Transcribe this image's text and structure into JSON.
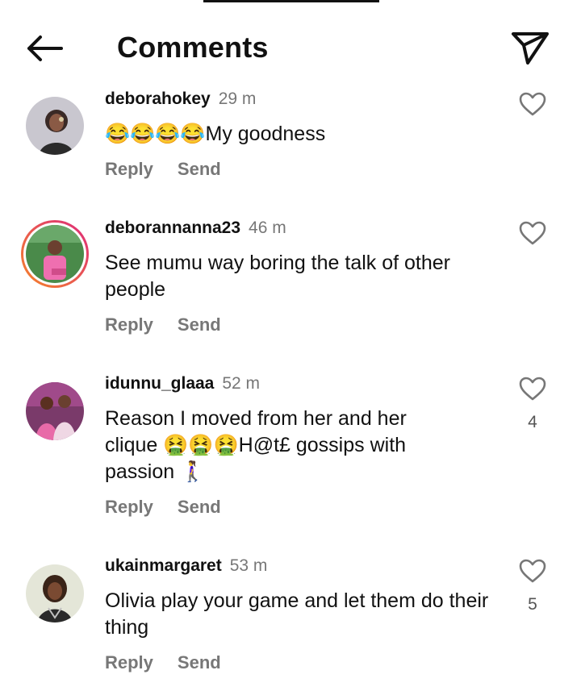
{
  "header": {
    "title": "Comments"
  },
  "comments": [
    {
      "username": "deborahokey",
      "time": "29 m",
      "text": "😂😂😂😂My goodness",
      "reply_label": "Reply",
      "send_label": "Send",
      "likes": ""
    },
    {
      "username": "deborannanna23",
      "time": "46 m",
      "text": "See mumu way boring the talk of other people",
      "reply_label": "Reply",
      "send_label": "Send",
      "likes": ""
    },
    {
      "username": "idunnu_glaaa",
      "time": "52 m",
      "text": "Reason I moved from her and her clique 🤮🤮🤮H@t£ gossips with passion 🚶‍♀️",
      "reply_label": "Reply",
      "send_label": "Send",
      "likes": "4"
    },
    {
      "username": "ukainmargaret",
      "time": "53 m",
      "text": "Olivia play your game and let them  do their thing",
      "reply_label": "Reply",
      "send_label": "Send",
      "likes": "5"
    }
  ],
  "icons": {
    "back": "arrow-left-icon",
    "send": "paper-plane-icon",
    "like": "heart-outline-icon"
  },
  "colors": {
    "story_ring_start": "#f58529",
    "story_ring_end": "#dd2a7b",
    "muted_text": "#777777"
  }
}
